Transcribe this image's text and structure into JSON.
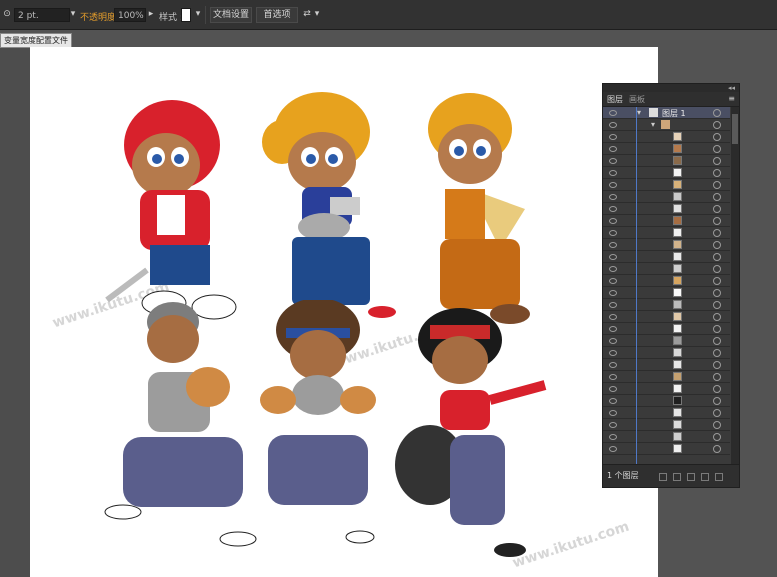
{
  "control_bar": {
    "stroke_value": "2 pt.",
    "opacity_label": "不透明度",
    "opacity_value": "100%",
    "style_label": "样式 :",
    "doc_setup_button": "文档设置",
    "prefs_button": "首选项"
  },
  "tooltip": "变量宽度配置文件",
  "watermark": "www.ikutu.com",
  "layers_panel": {
    "tab_layers": "图层",
    "tab_artboards": "画板",
    "top_layer_name": "图层 1",
    "footer_label": "1 个图层"
  },
  "colors": {
    "blue_line": "#4f78c7"
  }
}
